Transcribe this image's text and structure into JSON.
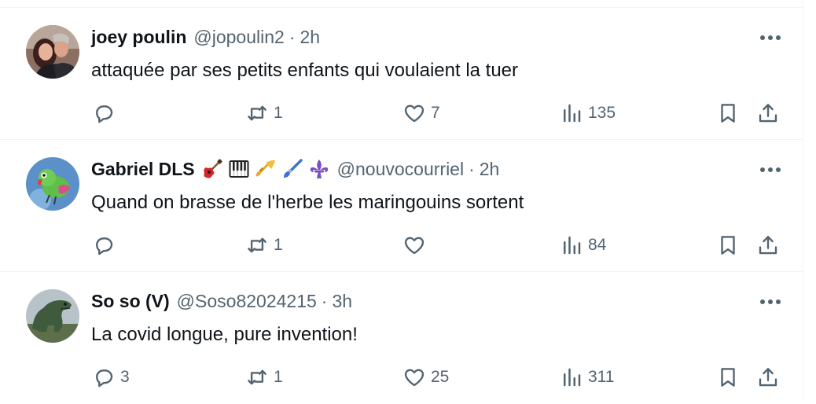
{
  "posts": [
    {
      "name": "joey poulin",
      "handle": "@jopoulin2",
      "separator": "·",
      "time": "2h",
      "text": "attaquée par ses petits enfants qui voulaient la tuer",
      "replies": "",
      "reposts": "1",
      "likes": "7",
      "views": "135",
      "avatar": "couple-photo-avatar"
    },
    {
      "name": "Gabriel DLS",
      "badges": [
        "guitar-emoji",
        "piano-keys-emoji",
        "trumpet-emoji",
        "paintbrush-emoji",
        "fleur-de-lis-emoji"
      ],
      "handle": "@nouvocourriel",
      "separator": "·",
      "time": "2h",
      "text": "Quand on brasse de l'herbe les maringouins sortent",
      "replies": "",
      "reposts": "1",
      "likes": "",
      "views": "84",
      "avatar": "lovebird-avatar"
    },
    {
      "name": "So so (V)",
      "handle": "@Soso82024215",
      "separator": "·",
      "time": "3h",
      "text": "La covid longue, pure invention!",
      "replies": "3",
      "reposts": "1",
      "likes": "25",
      "views": "311",
      "avatar": "dinosaur-avatar"
    }
  ],
  "colors": {
    "text": "#0f1419",
    "muted": "#536471",
    "divider": "#eff3f4"
  }
}
